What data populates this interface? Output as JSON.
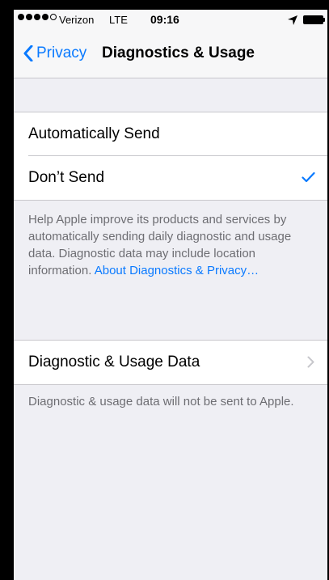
{
  "status": {
    "carrier": "Verizon",
    "network": "LTE",
    "time": "09:16"
  },
  "nav": {
    "back_label": "Privacy",
    "title": "Diagnostics & Usage"
  },
  "options": {
    "automatically_send": "Automatically Send",
    "dont_send": "Don’t Send",
    "selected": "Don’t Send"
  },
  "help": {
    "text": "Help Apple improve its products and services by automatically sending daily diagnostic and usage data. Diagnostic data may include location information. ",
    "link": "About Diagnostics & Privacy…"
  },
  "data_row": {
    "label": "Diagnostic & Usage Data"
  },
  "data_footer": "Diagnostic & usage data will not be sent to Apple.",
  "colors": {
    "accent": "#0a7aff",
    "background": "#efeff4",
    "footer_text": "#6d6d72"
  }
}
